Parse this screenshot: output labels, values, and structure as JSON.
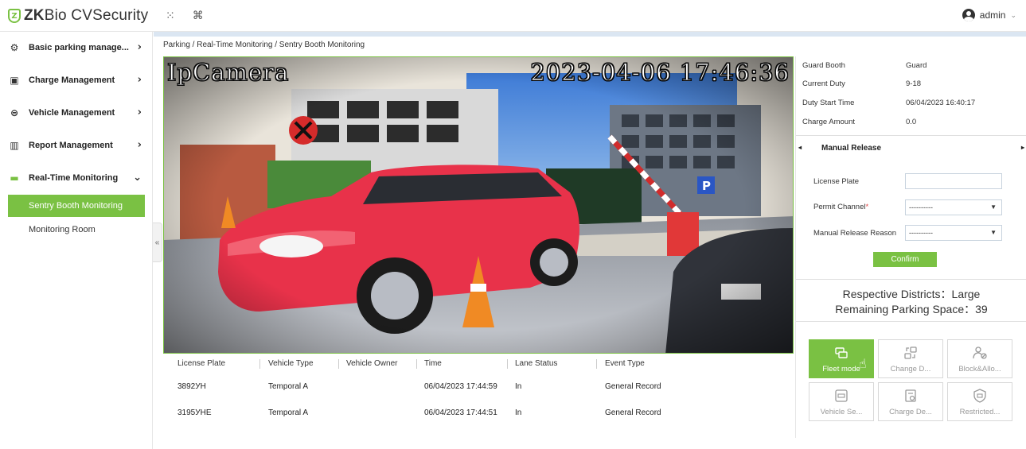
{
  "header": {
    "brand_prefix": "ZK",
    "brand_suffix": "Bio CVSecurity",
    "brand_shield_letter": "Z",
    "grid_icon": "grid-icon",
    "command_icon": "command-icon",
    "user_name": "admin"
  },
  "sidebar": {
    "items": [
      {
        "label": "Basic parking manage...",
        "icon": "gear-icon"
      },
      {
        "label": "Charge Management",
        "icon": "charge-icon"
      },
      {
        "label": "Vehicle Management",
        "icon": "car-icon"
      },
      {
        "label": "Report Management",
        "icon": "chart-icon"
      },
      {
        "label": "Real-Time Monitoring",
        "icon": "monitor-icon"
      }
    ],
    "sub_items": [
      "Sentry Booth Monitoring",
      "Monitoring Room"
    ],
    "collapse_label": "«"
  },
  "breadcrumb": "Parking / Real-Time Monitoring / Sentry Booth Monitoring",
  "video": {
    "camera_name": "IpCamera",
    "timestamp": "2023-04-06 17:46:36"
  },
  "records": {
    "columns": [
      "License Plate",
      "Vehicle Type",
      "Vehicle Owner",
      "Time",
      "Lane Status",
      "Event Type"
    ],
    "rows": [
      {
        "plate": "3892УН",
        "type": "Temporal A",
        "owner": "",
        "time": "06/04/2023 17:44:59",
        "lane": "In",
        "event": "General Record"
      },
      {
        "plate": "3195УНЕ",
        "type": "Temporal A",
        "owner": "",
        "time": "06/04/2023 17:44:51",
        "lane": "In",
        "event": "General Record"
      }
    ]
  },
  "info": {
    "guard_booth_label": "Guard Booth",
    "guard_booth_value": "Guard",
    "current_duty_label": "Current Duty",
    "current_duty_value": "9-18",
    "duty_start_label": "Duty Start Time",
    "duty_start_value": "06/04/2023 16:40:17",
    "charge_amount_label": "Charge Amount",
    "charge_amount_value": "0.0"
  },
  "manual_release": {
    "title": "Manual Release",
    "left_arrow": "◂",
    "right_arrow": "▸",
    "plate_label": "License Plate",
    "plate_value": "",
    "channel_label": "Permit Channel",
    "channel_required": "*",
    "channel_value": "----------",
    "reason_label": "Manual Release Reason",
    "reason_value": "----------",
    "confirm_label": "Confirm"
  },
  "district": {
    "line1": "Respective Districts：Large",
    "line2": "Remaining Parking Space：39"
  },
  "tiles": [
    {
      "label": "Fleet mode",
      "icon": "fleet-icon",
      "active": true
    },
    {
      "label": "Change D...",
      "icon": "change-icon",
      "active": false
    },
    {
      "label": "Block&Allo...",
      "icon": "block-allow-icon",
      "active": false
    },
    {
      "label": "Vehicle Se...",
      "icon": "vehicle-search-icon",
      "active": false
    },
    {
      "label": "Charge De...",
      "icon": "charge-detail-icon",
      "active": false
    },
    {
      "label": "Restricted...",
      "icon": "restricted-icon",
      "active": false
    }
  ],
  "colors": {
    "accent": "#7ac143",
    "accent_line": "#dbe6f2",
    "text": "#333333"
  }
}
